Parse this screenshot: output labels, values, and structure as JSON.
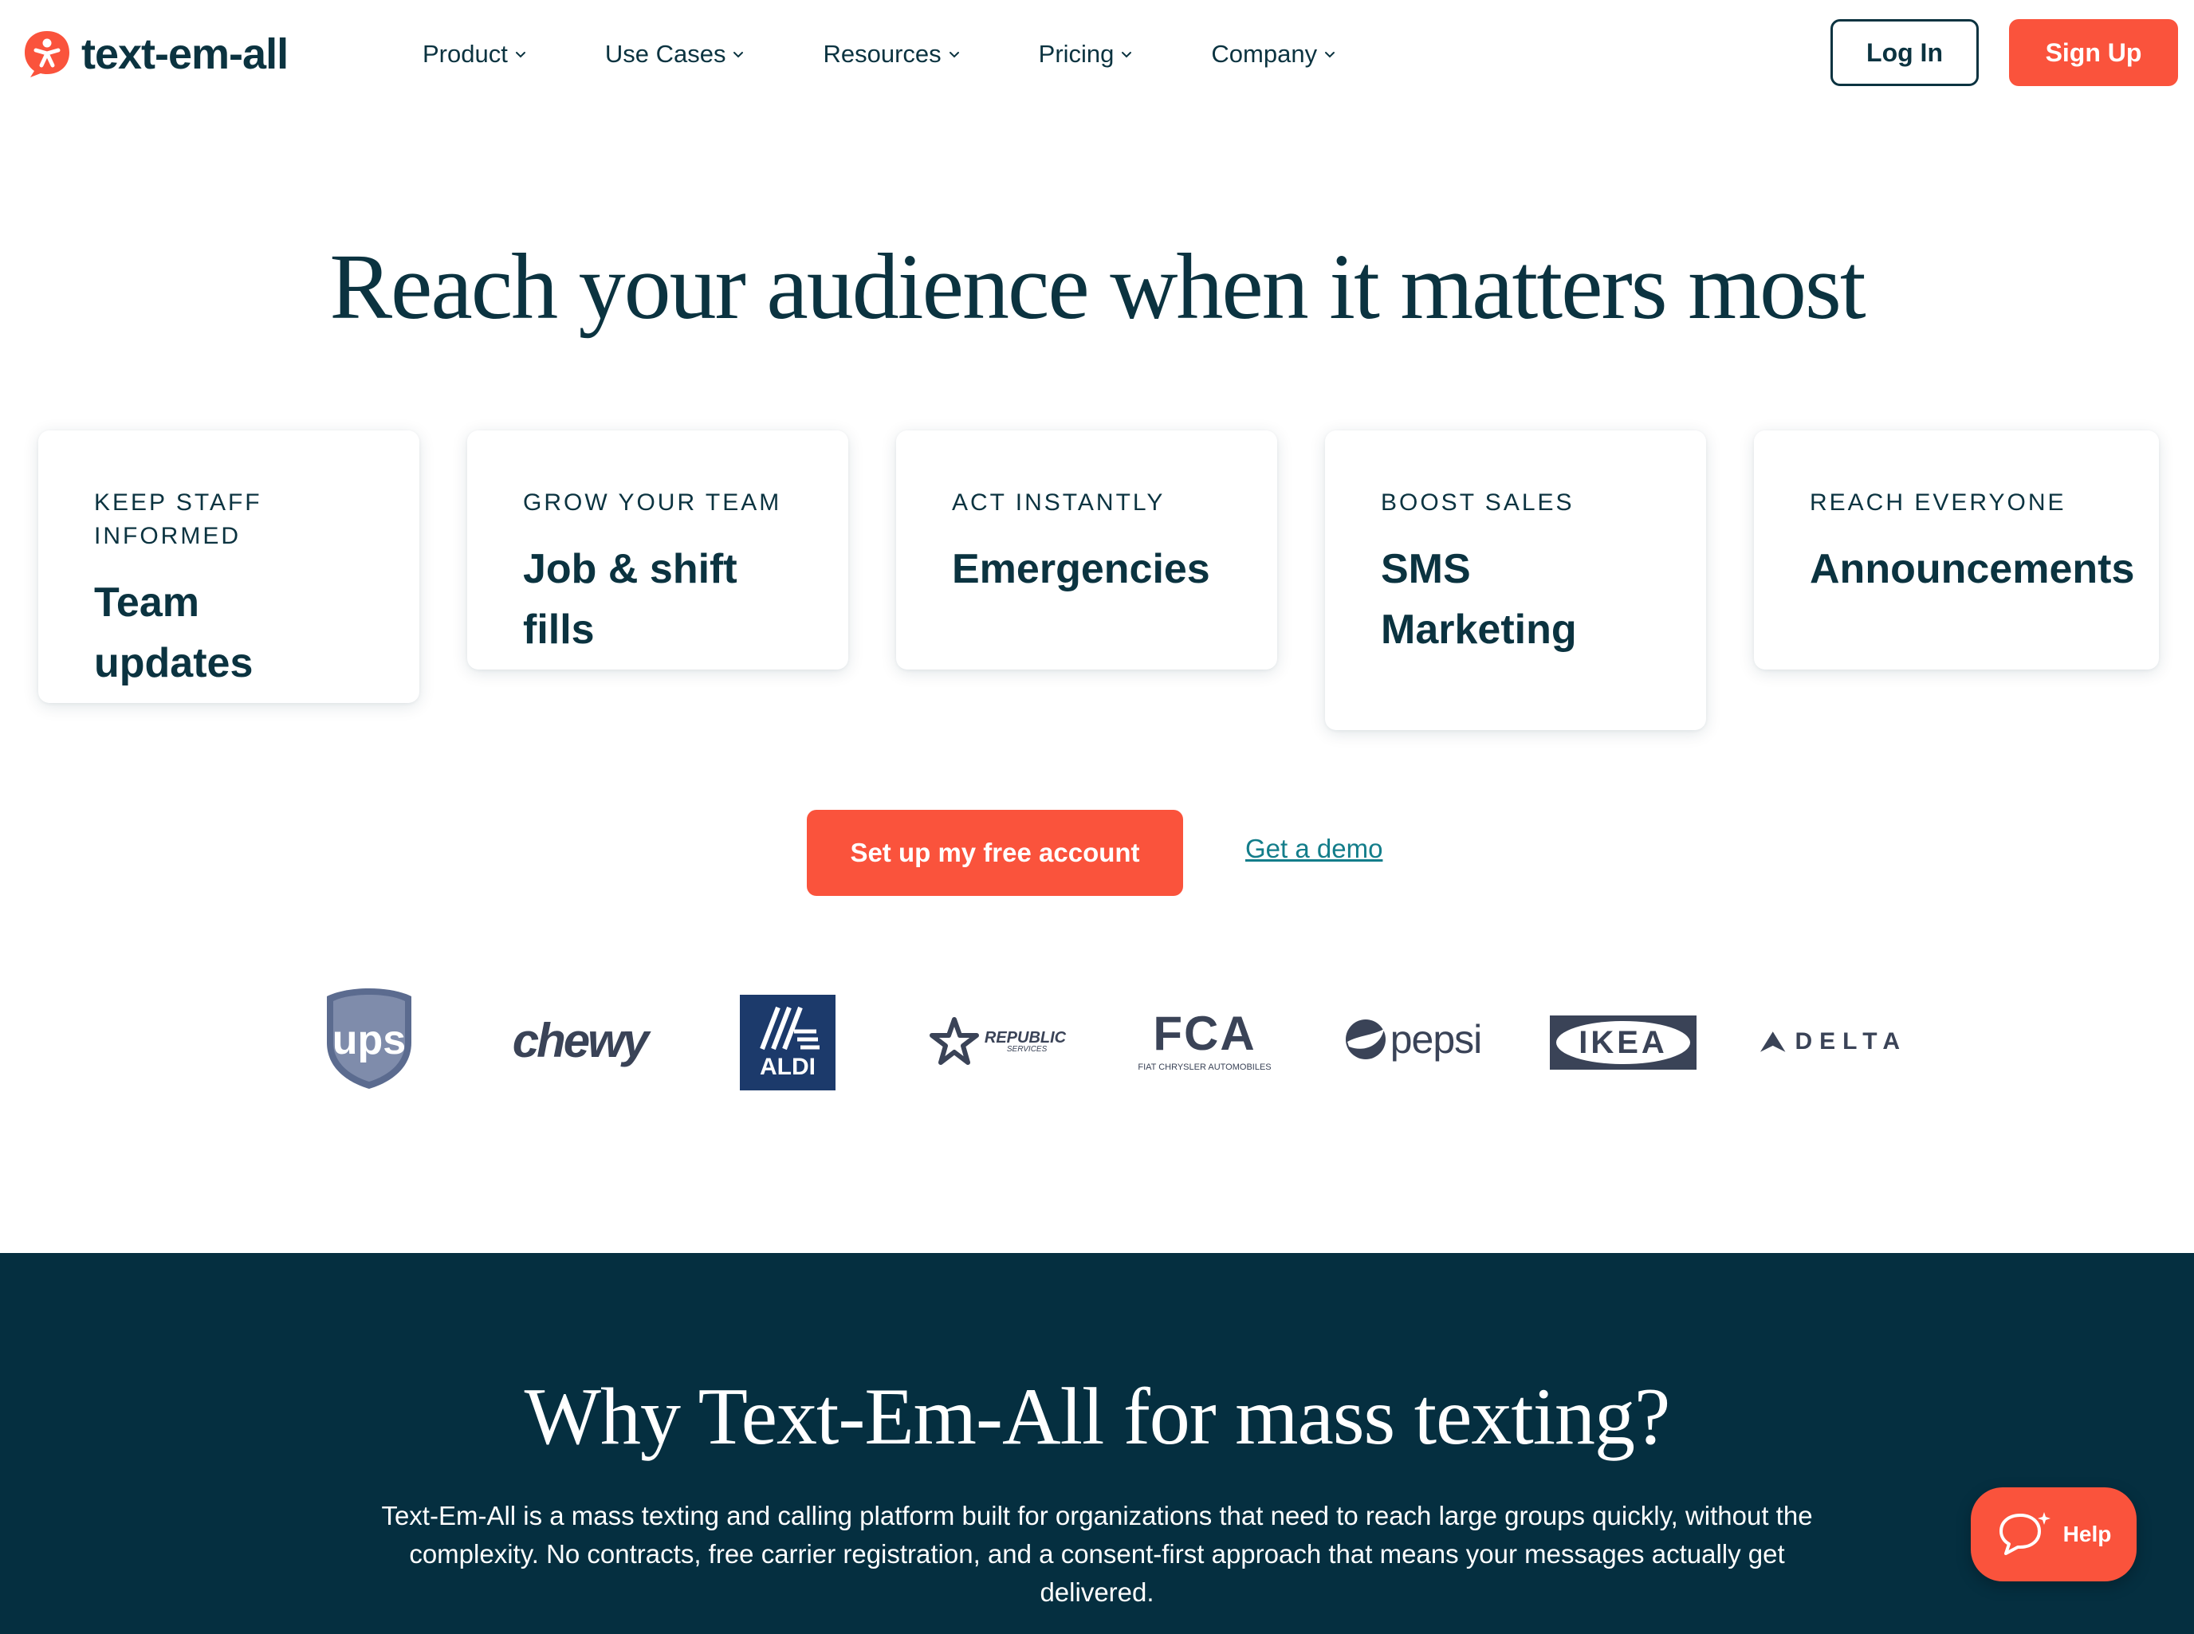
{
  "header": {
    "logo_text": "text-em-all",
    "nav": [
      {
        "label": "Product"
      },
      {
        "label": "Use Cases"
      },
      {
        "label": "Resources"
      },
      {
        "label": "Pricing"
      },
      {
        "label": "Company"
      }
    ],
    "login_label": "Log In",
    "signup_label": "Sign Up"
  },
  "hero": {
    "title": "Reach your audience when it matters most",
    "cards": [
      {
        "kicker": "KEEP STAFF INFORMED",
        "title": "Team updates"
      },
      {
        "kicker": "GROW YOUR TEAM",
        "title": "Job & shift fills"
      },
      {
        "kicker": "ACT INSTANTLY",
        "title": "Emergencies"
      },
      {
        "kicker": "BOOST SALES",
        "title": "SMS Marketing"
      },
      {
        "kicker": "REACH EVERYONE",
        "title": "Announcements"
      }
    ],
    "cta_primary": "Set up my free account",
    "cta_secondary": "Get a demo"
  },
  "logos": {
    "ups": "ups",
    "chewy": "chewy",
    "aldi": "ALDI",
    "republic_line1": "REPUBLIC",
    "republic_line2": "SERVICES",
    "fca": "FCA",
    "fca_sub": "FIAT CHRYSLER AUTOMOBILES",
    "pepsi": "pepsi",
    "ikea": "IKEA",
    "delta": "DELTA"
  },
  "why": {
    "title": "Why Text-Em-All for mass texting?",
    "body": "Text-Em-All is a mass texting and calling platform built for organizations that need to reach large groups quickly, without the complexity. No contracts, free carrier registration, and a consent-first approach that means your messages actually get delivered."
  },
  "help": {
    "label": "Help"
  },
  "colors": {
    "brand_orange": "#fa533c",
    "navy": "#0b3340",
    "dark_section": "#052f40",
    "link_teal": "#137d8a"
  },
  "icons": {
    "logo": "text-em-all-logo-icon",
    "chevron": "chevron-down-icon",
    "help": "chat-bubble-icon"
  }
}
